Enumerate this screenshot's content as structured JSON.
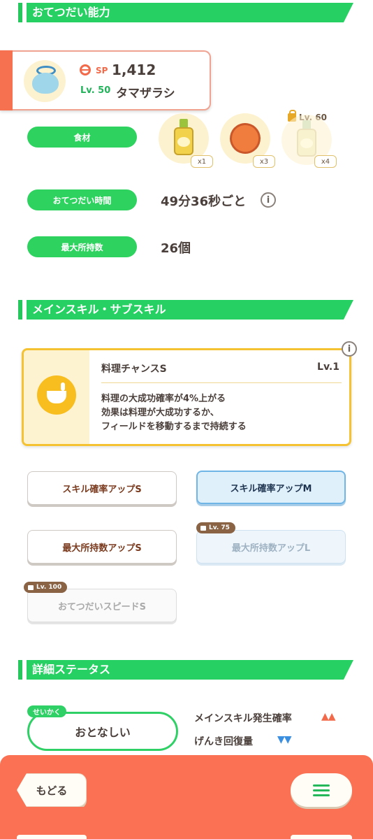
{
  "sections": {
    "helper_ability": "おてつだい能力",
    "main_sub_skill": "メインスキル・サブスキル",
    "detail_status": "詳細ステータス"
  },
  "pokemon": {
    "sp_label": "SP",
    "sp_value": "1,412",
    "level": "Lv. 50",
    "name": "タマザラシ"
  },
  "ingredients": {
    "label": "食材",
    "items": [
      {
        "icon": "oil-bottle-icon",
        "count": "x1"
      },
      {
        "icon": "sausage-icon",
        "count": "x3"
      },
      {
        "icon": "oil-bottle-icon",
        "count": "x4",
        "locked_level": "Lv. 60"
      }
    ]
  },
  "help_time": {
    "label": "おてつだい時間",
    "value": "49分36秒ごと",
    "info": "i"
  },
  "max_carry": {
    "label": "最大所持数",
    "value": "26個"
  },
  "main_skill": {
    "info": "i",
    "title": "料理チャンスS",
    "level": "Lv.1",
    "desc_line1": "料理の大成功確率が4%上がる",
    "desc_line2": "効果は料理が大成功するか、",
    "desc_line3": "フィールドを移動するまで持続する"
  },
  "sub_skills": [
    {
      "label": "スキル確率アップS",
      "state": "normal"
    },
    {
      "label": "スキル確率アップM",
      "state": "selected"
    },
    {
      "label": "最大所持数アップS",
      "state": "normal"
    },
    {
      "label": "最大所持数アップL",
      "state": "locked",
      "lock_level": "Lv. 75"
    },
    {
      "label": "おてつだいスピードS",
      "state": "locked",
      "lock_level": "Lv. 100"
    }
  ],
  "nature": {
    "tag": "せいかく",
    "value": "おとなしい",
    "up_label": "メインスキル発生確率",
    "up_arrows": "▲▲",
    "down_label": "げんき回復量",
    "down_arrows": "▼▼"
  },
  "colors": {
    "green": "#26d063",
    "orange": "#fa7253",
    "up_arrow": "#f26a4a",
    "down_arrow": "#3b8fe0"
  },
  "footer": {
    "back_label": "もどる",
    "menu_icon": "hamburger-menu-icon"
  }
}
